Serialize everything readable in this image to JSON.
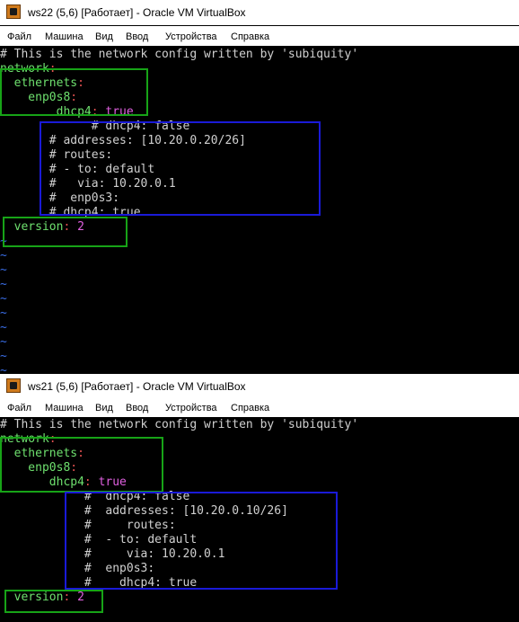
{
  "windows": [
    {
      "title": "ws22 (5,6) [Работает] - Oracle VM VirtualBox",
      "menu": [
        "Файл",
        "Машина",
        "Вид",
        "Ввод",
        "Устройства",
        "Справка"
      ],
      "lines": [
        {
          "segs": [
            {
              "t": "# This is the network config written by 'subiquity'",
              "c": "c"
            }
          ]
        },
        {
          "segs": [
            {
              "t": "network",
              "c": "k"
            },
            {
              "t": ":",
              "c": "r"
            }
          ]
        },
        {
          "segs": [
            {
              "t": "  ethernets",
              "c": "k"
            },
            {
              "t": ":",
              "c": "r"
            }
          ]
        },
        {
          "segs": [
            {
              "t": "    enp0s8",
              "c": "k"
            },
            {
              "t": ":",
              "c": "r"
            }
          ]
        },
        {
          "segs": [
            {
              "t": "        dhcp4",
              "c": "k"
            },
            {
              "t": ": ",
              "c": "r"
            },
            {
              "t": "true",
              "c": "m"
            }
          ]
        },
        {
          "segs": [
            {
              "t": "             # dhcp4: false",
              "c": "c"
            }
          ]
        },
        {
          "segs": [
            {
              "t": "       # addresses: [10.20.0.20/26]",
              "c": "c"
            }
          ]
        },
        {
          "segs": [
            {
              "t": "       # routes:",
              "c": "c"
            }
          ]
        },
        {
          "segs": [
            {
              "t": "       # - to: default",
              "c": "c"
            }
          ]
        },
        {
          "segs": [
            {
              "t": "       #   via: 10.20.0.1",
              "c": "c"
            }
          ]
        },
        {
          "segs": [
            {
              "t": "       #  enp0s3:",
              "c": "c"
            }
          ]
        },
        {
          "segs": [
            {
              "t": "       # dhcp4: true",
              "c": "c"
            }
          ]
        },
        {
          "segs": [
            {
              "t": "",
              "c": "c"
            }
          ]
        },
        {
          "segs": [
            {
              "t": "  version",
              "c": "k"
            },
            {
              "t": ": ",
              "c": "r"
            },
            {
              "t": "2",
              "c": "m"
            }
          ]
        },
        {
          "segs": [
            {
              "t": "~",
              "c": "t"
            }
          ]
        },
        {
          "segs": [
            {
              "t": "~",
              "c": "t"
            }
          ]
        },
        {
          "segs": [
            {
              "t": "~",
              "c": "t"
            }
          ]
        },
        {
          "segs": [
            {
              "t": "~",
              "c": "t"
            }
          ]
        },
        {
          "segs": [
            {
              "t": "~",
              "c": "t"
            }
          ]
        },
        {
          "segs": [
            {
              "t": "~",
              "c": "t"
            }
          ]
        },
        {
          "segs": [
            {
              "t": "~",
              "c": "t"
            }
          ]
        },
        {
          "segs": [
            {
              "t": "~",
              "c": "t"
            }
          ]
        },
        {
          "segs": [
            {
              "t": "~",
              "c": "t"
            }
          ]
        },
        {
          "segs": [
            {
              "t": "~",
              "c": "t"
            }
          ]
        }
      ]
    },
    {
      "title": "ws21 (5,6) [Работает] - Oracle VM VirtualBox",
      "menu": [
        "Файл",
        "Машина",
        "Вид",
        "Ввод",
        "Устройства",
        "Справка"
      ],
      "lines": [
        {
          "segs": [
            {
              "t": "# This is the network config written by 'subiquity'",
              "c": "c"
            }
          ]
        },
        {
          "segs": [
            {
              "t": "network",
              "c": "k"
            },
            {
              "t": ":",
              "c": "r"
            }
          ]
        },
        {
          "segs": [
            {
              "t": "  ethernets",
              "c": "k"
            },
            {
              "t": ":",
              "c": "r"
            }
          ]
        },
        {
          "segs": [
            {
              "t": "    enp0s8",
              "c": "k"
            },
            {
              "t": ":",
              "c": "r"
            }
          ]
        },
        {
          "segs": [
            {
              "t": "       dhcp4",
              "c": "k"
            },
            {
              "t": ": ",
              "c": "r"
            },
            {
              "t": "true",
              "c": "m"
            }
          ]
        },
        {
          "segs": [
            {
              "t": "            #  dhcp4: false",
              "c": "c"
            }
          ]
        },
        {
          "segs": [
            {
              "t": "            #  addresses: [10.20.0.10/26]",
              "c": "c"
            }
          ]
        },
        {
          "segs": [
            {
              "t": "            #     routes:",
              "c": "c"
            }
          ]
        },
        {
          "segs": [
            {
              "t": "            #  - to: default",
              "c": "c"
            }
          ]
        },
        {
          "segs": [
            {
              "t": "            #     via: 10.20.0.1",
              "c": "c"
            }
          ]
        },
        {
          "segs": [
            {
              "t": "            #  enp0s3:",
              "c": "c"
            }
          ]
        },
        {
          "segs": [
            {
              "t": "            #    dhcp4: true",
              "c": "c"
            }
          ]
        },
        {
          "segs": [
            {
              "t": "",
              "c": "c"
            }
          ]
        },
        {
          "segs": [
            {
              "t": "  version",
              "c": "k"
            },
            {
              "t": ": ",
              "c": "r"
            },
            {
              "t": "2",
              "c": "m"
            }
          ]
        }
      ]
    }
  ]
}
